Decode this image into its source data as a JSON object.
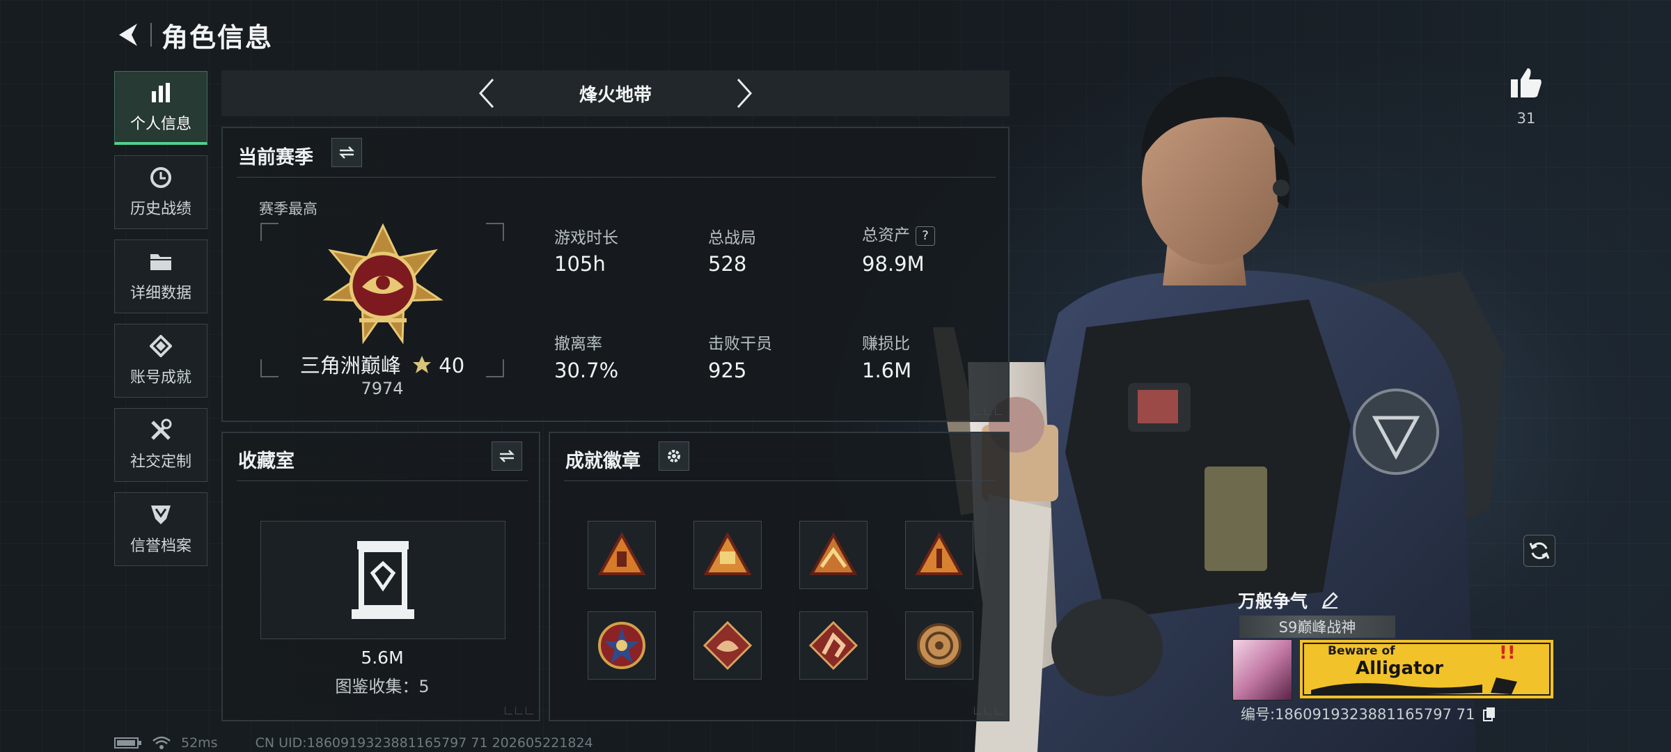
{
  "header": {
    "title": "角色信息"
  },
  "sidebar": {
    "items": [
      {
        "label": "个人信息",
        "icon": "bar-chart-icon"
      },
      {
        "label": "历史战绩",
        "icon": "clock-icon"
      },
      {
        "label": "详细数据",
        "icon": "folder-icon"
      },
      {
        "label": "账号成就",
        "icon": "achievement-icon"
      },
      {
        "label": "社交定制",
        "icon": "tools-icon"
      },
      {
        "label": "信誉档案",
        "icon": "shield-icon"
      }
    ]
  },
  "mode": {
    "title": "烽火地带"
  },
  "season": {
    "title": "当前赛季",
    "best_label": "赛季最高",
    "rank_name": "三角洲巅峰",
    "rank_stars": "40",
    "rank_score": "7974",
    "stats": [
      {
        "label": "游戏时长",
        "value": "105h"
      },
      {
        "label": "总战局",
        "value": "528"
      },
      {
        "label": "总资产",
        "value": "98.9M",
        "help": "?"
      },
      {
        "label": "撤离率",
        "value": "30.7%"
      },
      {
        "label": "击败干员",
        "value": "925"
      },
      {
        "label": "赚损比",
        "value": "1.6M"
      }
    ]
  },
  "collection": {
    "title": "收藏室",
    "value": "5.6M",
    "count_text": "图鉴收集：5"
  },
  "badges": {
    "title": "成就徽章",
    "items": [
      "badge-1",
      "badge-2",
      "badge-3",
      "badge-4",
      "badge-5",
      "badge-6",
      "badge-7",
      "badge-8"
    ]
  },
  "player": {
    "likes": "31",
    "name": "万般争气",
    "title_tag": "S9巅峰战神",
    "card_line1": "Beware of",
    "card_line2": "Alligator",
    "id_text": "编号:1860919323881165797 71"
  },
  "status": {
    "ping": "52ms",
    "uid": "CN UID:1860919323881165797 71 202605221824"
  },
  "colors": {
    "accent": "#4fd28f",
    "card_yellow": "#f2c22a"
  }
}
